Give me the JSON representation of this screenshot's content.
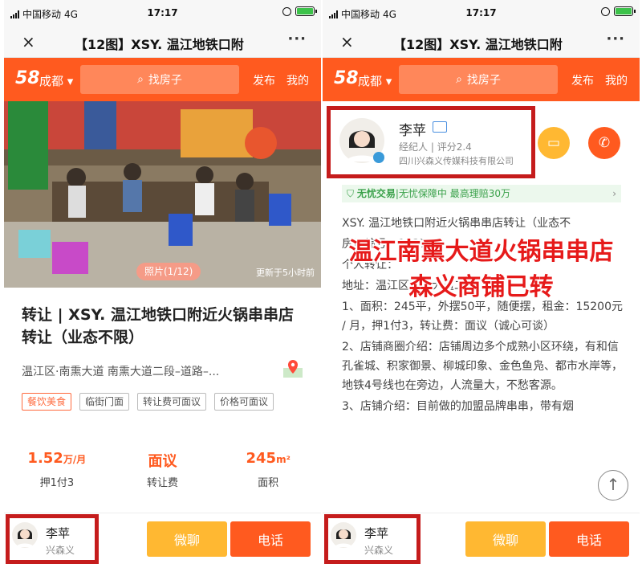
{
  "status": {
    "carrier": "中国移动",
    "network": "4G",
    "time": "17:17"
  },
  "nav": {
    "close_icon": "×",
    "title": "【12图】XSY. 温江地铁口附",
    "more": "···"
  },
  "header": {
    "logo": "58",
    "city": "成都",
    "search_placeholder": "找房子",
    "publish": "发布",
    "mine": "我的"
  },
  "listing": {
    "photo_badge": "照片(1/12)",
    "updated": "更新于5小时前",
    "title": "转让 | XSY. 温江地铁口附近火锅串串店转让（业态不限）",
    "address": "温江区·南熏大道 南熏大道二段–道路–...",
    "tags": [
      "餐饮美食",
      "临街门面",
      "转让费可面议",
      "价格可面议"
    ],
    "rent_value": "1.52",
    "rent_unit": "万/月",
    "rent_label": "押1付3",
    "fee_value": "面议",
    "fee_label": "转让费",
    "area_value": "245",
    "area_unit": "m²",
    "area_label": "面积"
  },
  "contact": {
    "name": "李苹",
    "company": "兴森义",
    "chat": "微聊",
    "call": "电话"
  },
  "agent": {
    "name": "李苹",
    "role": "经纪人",
    "rating": "评分2.4",
    "company": "四川兴森义传媒科技有限公司"
  },
  "trust": {
    "brand": "无忧交易",
    "text": "|无忧保障中 最高理赔30万",
    "arrow": "›"
  },
  "detail": {
    "title": "XSY. 温江地铁口附近火锅串串店转让（业态不",
    "code": "房源编号：13374",
    "personal": "个人转让：",
    "address": "地址：温江区南熏大道二段",
    "p1": "1、面积：245平，外摆50平，随便摆，租金：15200元 / 月，押1付3，转让费：面议（诚心可谈）",
    "p2": "2、店铺商圈介绍：店铺周边多个成熟小区环绕，有和信孔雀城、积家御景、柳城印象、金色鱼凫、都市水岸等，地铁4号线也在旁边，人流量大，不愁客源。",
    "p3": "3、店铺介绍：目前做的加盟品牌串串，带有烟"
  },
  "overlay": {
    "line1": "温江南熏大道火锅串串店",
    "line2": "森义商铺已转"
  },
  "colors": {
    "brand": "#ff5a1f",
    "highlight_box": "#c51c1c",
    "overlay_text": "#e61a1a"
  }
}
